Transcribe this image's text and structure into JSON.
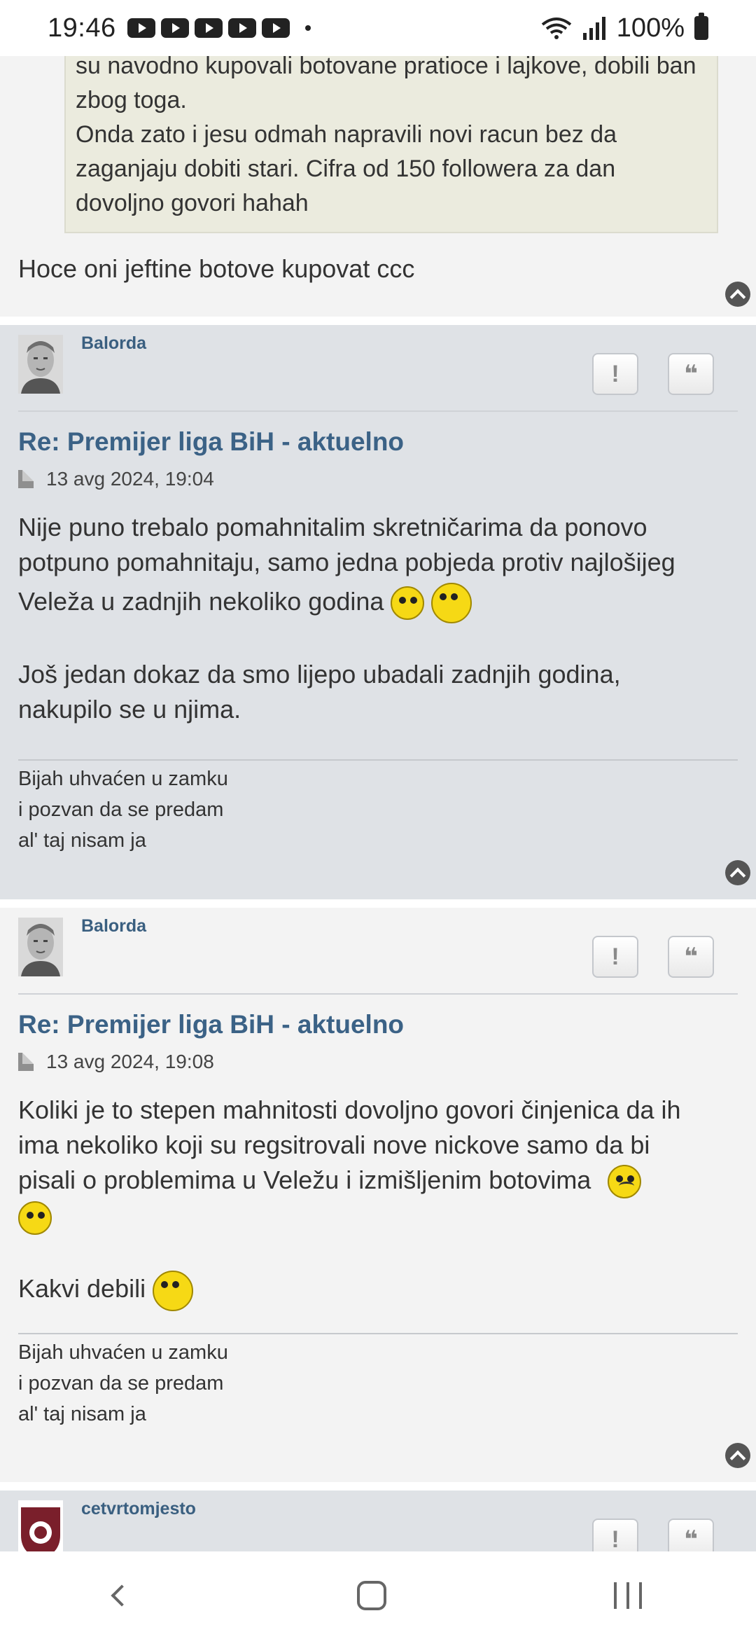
{
  "status_bar": {
    "time": "19:46",
    "battery": "100%"
  },
  "post0": {
    "quote_lines": [
      "su navodno kupovali botovane pratioce i lajkove, dobili ban",
      "zbog toga.",
      "Onda zato i jesu odmah napravili novi racun bez da",
      "zaganjaju dobiti stari. Cifra od 150 followera za dan",
      "dovoljno govori hahah"
    ],
    "text": "Hoce oni jeftine botove kupovat ccc"
  },
  "post1": {
    "username": "Balorda",
    "report_label": "!",
    "quote_label": "❝",
    "title": "Re: Premijer liga BiH - aktuelno",
    "date": "13 avg 2024, 19:04",
    "p1_lines": [
      "Nije puno trebalo pomahnitalim skretničarima da ponovo",
      "potpuno pomahnitaju, samo jedna pobjeda protiv najlošijeg",
      "Veleža u zadnjih nekoliko godina"
    ],
    "p2_lines": [
      "Još jedan dokaz da smo lijepo ubadali zadnjih godina,",
      "nakupilo se u njima."
    ],
    "signature": [
      "Bijah uhvaćen u zamku",
      "i pozvan da se predam",
      "al' taj nisam ja"
    ]
  },
  "post2": {
    "username": "Balorda",
    "report_label": "!",
    "quote_label": "❝",
    "title": "Re: Premijer liga BiH - aktuelno",
    "date": "13 avg 2024, 19:08",
    "p1_lines": [
      "Koliki je to stepen mahnitosti dovoljno govori činjenica da ih",
      "ima nekoliko koji su regsitrovali nove nickove samo da bi",
      "pisali o problemima u Veležu i izmišljenim botovima"
    ],
    "p2": "Kakvi debili",
    "signature": [
      "Bijah uhvaćen u zamku",
      "i pozvan da se predam",
      "al' taj nisam ja"
    ]
  },
  "post3": {
    "username": "cetvrtomjesto",
    "report_label": "!",
    "quote_label": "❝"
  },
  "colors": {
    "link": "#3b6286",
    "post_alt_bg": "#dfe2e6",
    "post_bg": "#f3f3f3",
    "quote_bg": "#ebebde"
  }
}
